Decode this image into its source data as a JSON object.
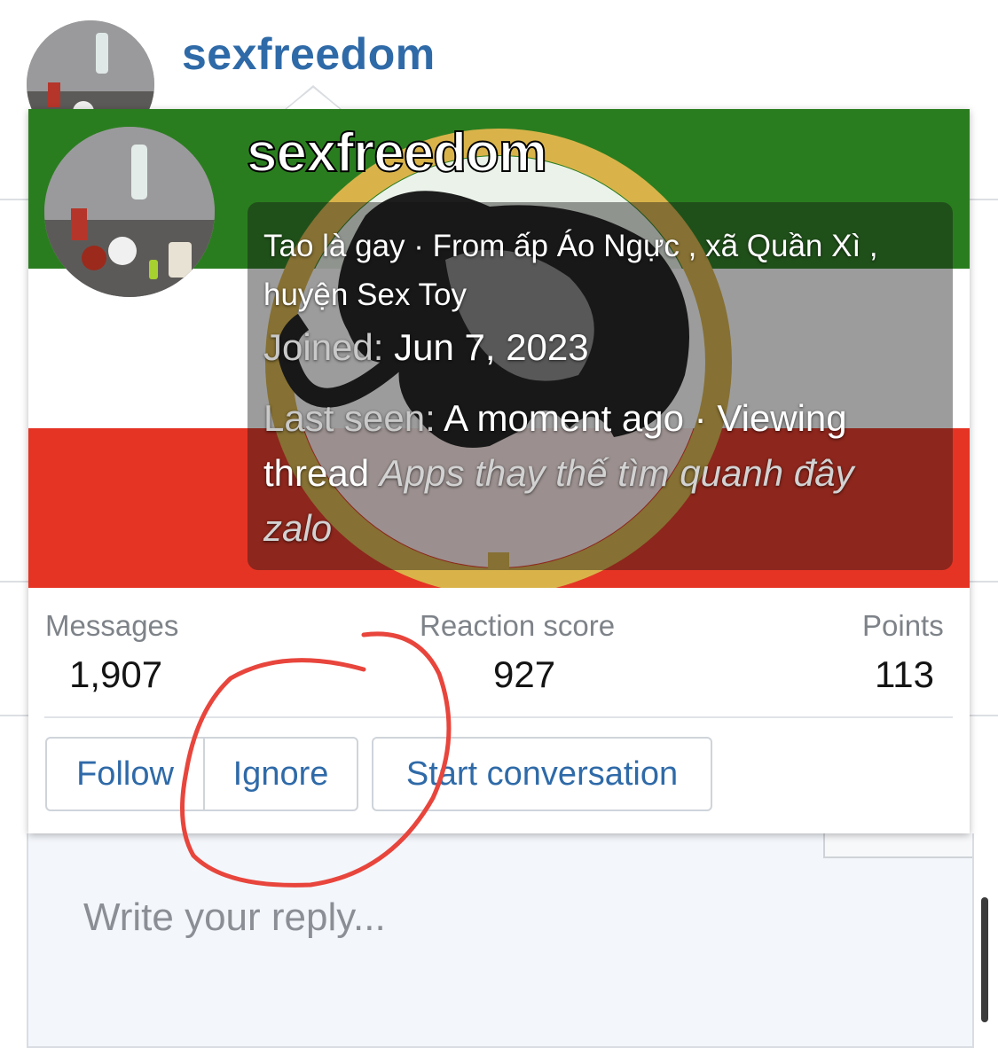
{
  "background": {
    "username": "sexfreedom",
    "reply_placeholder": "Write your reply..."
  },
  "tooltip": {
    "username": "sexfreedom",
    "blurb": "Tao là gay · From ấp Áo Ngực , xã Quần Xì , huyện Sex Toy",
    "joined_label": "Joined:",
    "joined_value": "Jun 7, 2023",
    "last_seen_label": "Last seen:",
    "last_seen_value": "A moment ago",
    "activity_prefix": "· Viewing thread",
    "activity_thread": "Apps thay thế tìm quanh đây zalo",
    "stats": [
      {
        "label": "Messages",
        "value": "1,907"
      },
      {
        "label": "Reaction score",
        "value": "927"
      },
      {
        "label": "Points",
        "value": "113"
      }
    ],
    "buttons": {
      "follow": "Follow",
      "ignore": "Ignore",
      "start_conversation": "Start conversation"
    },
    "banner_colors": [
      "#2a7d1f",
      "#ffffff",
      "#e53424"
    ]
  },
  "colors": {
    "link_blue": "#2f6aa8",
    "annotation_red": "#e8453c"
  }
}
